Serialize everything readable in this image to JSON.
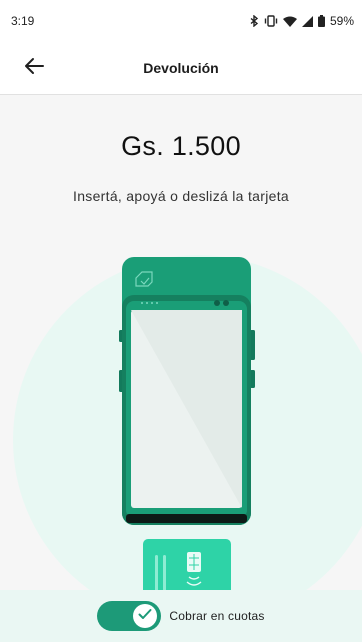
{
  "status_bar": {
    "time": "3:19",
    "battery": "59%",
    "icons": [
      "bluetooth-icon",
      "vibrate-icon",
      "wifi-icon",
      "signal-icon",
      "battery-icon"
    ]
  },
  "app_bar": {
    "back_icon": "arrow-left-icon",
    "title": "Devolución"
  },
  "payment": {
    "amount": "Gs. 1.500",
    "instruction": "Insertá, apoyá o deslizá la tarjeta"
  },
  "bottom": {
    "toggle_on": true,
    "toggle_label": "Cobrar en cuotas"
  },
  "colors": {
    "accent": "#1d9a78",
    "device_green": "#1a9e77",
    "device_dark": "#137a5c",
    "circle_bg": "#e8f8f3",
    "card_green": "#2ed3a7"
  }
}
